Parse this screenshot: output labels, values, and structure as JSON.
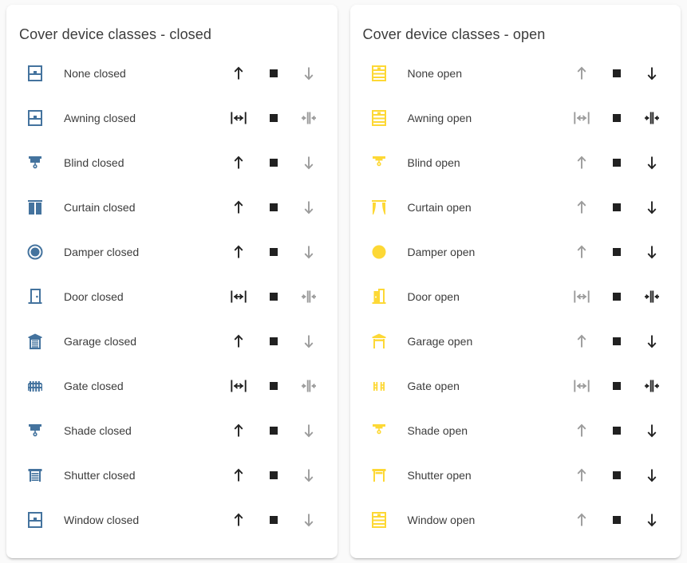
{
  "colors": {
    "page_background": "#fafafa",
    "card_background": "#ffffff",
    "closed_icon": "#44739e",
    "open_icon": "#fdd835",
    "control_active": "#212121",
    "control_disabled": "#9b9b9b",
    "text": "#3c3c3c"
  },
  "cards": [
    {
      "title": "Cover device classes - closed",
      "state": "closed",
      "rows": [
        {
          "icon": "window-shutter-icon",
          "label": "None closed",
          "controls": [
            "up",
            "stop",
            "down"
          ],
          "enabled": [
            true,
            true,
            false
          ]
        },
        {
          "icon": "window-shutter-icon",
          "label": "Awning closed",
          "controls": [
            "open-horizontal",
            "stop",
            "close-horizontal"
          ],
          "enabled": [
            true,
            true,
            false
          ]
        },
        {
          "icon": "blinds-icon",
          "label": "Blind closed",
          "controls": [
            "up",
            "stop",
            "down"
          ],
          "enabled": [
            true,
            true,
            false
          ]
        },
        {
          "icon": "curtains-closed-icon",
          "label": "Curtain closed",
          "controls": [
            "up",
            "stop",
            "down"
          ],
          "enabled": [
            true,
            true,
            false
          ]
        },
        {
          "icon": "circle-damper-icon",
          "label": "Damper closed",
          "controls": [
            "up",
            "stop",
            "down"
          ],
          "enabled": [
            true,
            true,
            false
          ]
        },
        {
          "icon": "door-closed-icon",
          "label": "Door closed",
          "controls": [
            "open-horizontal",
            "stop",
            "close-horizontal"
          ],
          "enabled": [
            true,
            true,
            false
          ]
        },
        {
          "icon": "garage-closed-icon",
          "label": "Garage closed",
          "controls": [
            "up",
            "stop",
            "down"
          ],
          "enabled": [
            true,
            true,
            false
          ]
        },
        {
          "icon": "gate-closed-icon",
          "label": "Gate closed",
          "controls": [
            "open-horizontal",
            "stop",
            "close-horizontal"
          ],
          "enabled": [
            true,
            true,
            false
          ]
        },
        {
          "icon": "blinds-icon",
          "label": "Shade closed",
          "controls": [
            "up",
            "stop",
            "down"
          ],
          "enabled": [
            true,
            true,
            false
          ]
        },
        {
          "icon": "shutter-closed-icon",
          "label": "Shutter closed",
          "controls": [
            "up",
            "stop",
            "down"
          ],
          "enabled": [
            true,
            true,
            false
          ]
        },
        {
          "icon": "window-shutter-icon",
          "label": "Window closed",
          "controls": [
            "up",
            "stop",
            "down"
          ],
          "enabled": [
            true,
            true,
            false
          ]
        }
      ]
    },
    {
      "title": "Cover device classes - open",
      "state": "open",
      "rows": [
        {
          "icon": "window-shutter-open-icon",
          "label": "None open",
          "controls": [
            "up",
            "stop",
            "down"
          ],
          "enabled": [
            false,
            true,
            true
          ]
        },
        {
          "icon": "window-shutter-open-icon",
          "label": "Awning open",
          "controls": [
            "open-horizontal",
            "stop",
            "close-horizontal"
          ],
          "enabled": [
            false,
            true,
            true
          ]
        },
        {
          "icon": "blinds-open-icon",
          "label": "Blind open",
          "controls": [
            "up",
            "stop",
            "down"
          ],
          "enabled": [
            false,
            true,
            true
          ]
        },
        {
          "icon": "curtains-open-icon",
          "label": "Curtain open",
          "controls": [
            "up",
            "stop",
            "down"
          ],
          "enabled": [
            false,
            true,
            true
          ]
        },
        {
          "icon": "circle-damper-open-icon",
          "label": "Damper open",
          "controls": [
            "up",
            "stop",
            "down"
          ],
          "enabled": [
            false,
            true,
            true
          ]
        },
        {
          "icon": "door-open-icon",
          "label": "Door open",
          "controls": [
            "open-horizontal",
            "stop",
            "close-horizontal"
          ],
          "enabled": [
            false,
            true,
            true
          ]
        },
        {
          "icon": "garage-open-icon",
          "label": "Garage open",
          "controls": [
            "up",
            "stop",
            "down"
          ],
          "enabled": [
            false,
            true,
            true
          ]
        },
        {
          "icon": "gate-open-icon",
          "label": "Gate open",
          "controls": [
            "open-horizontal",
            "stop",
            "close-horizontal"
          ],
          "enabled": [
            false,
            true,
            true
          ]
        },
        {
          "icon": "blinds-open-icon",
          "label": "Shade open",
          "controls": [
            "up",
            "stop",
            "down"
          ],
          "enabled": [
            false,
            true,
            true
          ]
        },
        {
          "icon": "shutter-open-icon",
          "label": "Shutter open",
          "controls": [
            "up",
            "stop",
            "down"
          ],
          "enabled": [
            false,
            true,
            true
          ]
        },
        {
          "icon": "window-shutter-open-icon",
          "label": "Window open",
          "controls": [
            "up",
            "stop",
            "down"
          ],
          "enabled": [
            false,
            true,
            true
          ]
        }
      ]
    }
  ]
}
